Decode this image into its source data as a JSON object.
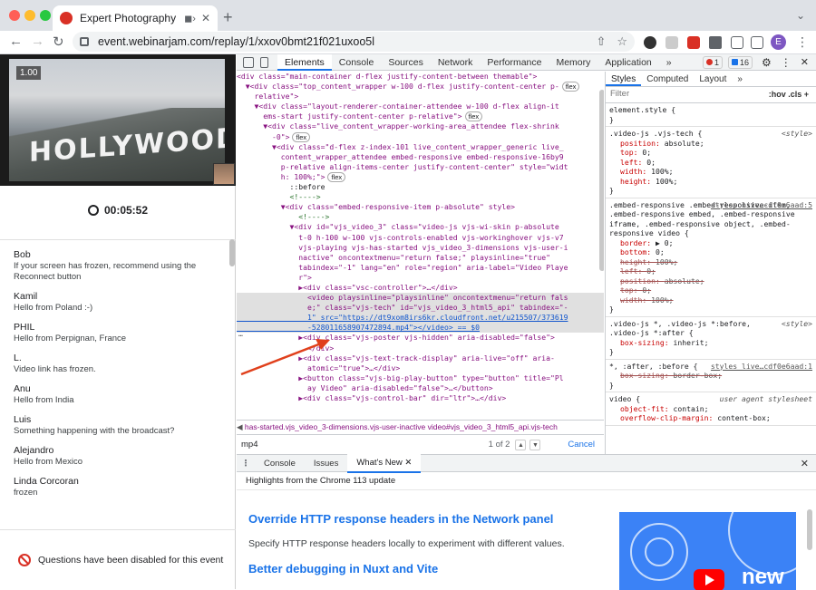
{
  "browser": {
    "tab_title": "Expert Photography Secre",
    "url": "event.webinarjam.com/replay/1/xxov0bmt21f021uxoo5l",
    "profile_initial": "E",
    "colors": {
      "close": "#ff5f57",
      "minimize": "#febc2e",
      "maximize": "#28c840",
      "tab_favicon": "#d93025"
    }
  },
  "webinar": {
    "speed": "1.00",
    "sign_text": "HOLLYWOOD",
    "timer": "00:05:52",
    "chat": [
      {
        "name": "Bob",
        "text": "If your screen has frozen, recommend using the Reconnect button"
      },
      {
        "name": "Kamil",
        "text": "Hello from Poland :-)"
      },
      {
        "name": "PHIL",
        "text": "Hello from Perpignan, France"
      },
      {
        "name": "L.",
        "text": "Video link has frozen."
      },
      {
        "name": "Anu",
        "text": "Hello from India"
      },
      {
        "name": "Luis",
        "text": "Something happening with the broadcast?"
      },
      {
        "name": "Alejandro",
        "text": "Hello from Mexico"
      },
      {
        "name": "Linda Corcoran",
        "text": "frozen"
      }
    ],
    "questions_disabled": "Questions have been disabled for this event"
  },
  "devtools": {
    "tabs": [
      "Elements",
      "Console",
      "Sources",
      "Network",
      "Performance",
      "Memory",
      "Application"
    ],
    "more_tabs": "»",
    "error_count": "1",
    "message_count": "16",
    "elements_lines": [
      "<div class=\"main-container d-flex justify-content-between themable\">",
      "  ▼<div class=\"top_content_wrapper w-100 d-flex justify-content-center p-",
      "    relative\">",
      "    ▼<div class=\"layout-renderer-container-attendee w-100 d-flex align-it",
      "      ems-start justify-content-center p-relative\">",
      "      ▼<div class=\"live_content_wrapper-working-area_attendee flex-shrink",
      "        -0\">",
      "        ▼<div class=\"d-flex z-index-101 live_content_wrapper_generic live_",
      "          content_wrapper_attendee embed-responsive embed-responsive-16by9",
      "          p-relative align-items-center justify-content-center\" style=\"widt",
      "          h: 100%;\">",
      "            ::before",
      "            <!---->",
      "          ▼<div class=\"embed-responsive-item p-absolute\" style>",
      "              <!---->",
      "            ▼<div id=\"vjs_video_3\" class=\"video-js vjs-wi-skin p-absolute",
      "              t-0 h-100 w-100 vjs-controls-enabled vjs-workinghover vjs-v7",
      "              vjs-playing vjs-has-started vjs_video_3-dimensions vjs-user-i",
      "              nactive\" oncontextmenu=\"return false;\" playsinline=\"true\"",
      "              tabindex=\"-1\" lang=\"en\" role=\"region\" aria-label=\"Video Playe",
      "              r\">",
      "              ▶<div class=\"vsc-controller\">…</div>",
      "                <video playsinline=\"playsinline\" oncontextmenu=\"return fals",
      "                e;\" class=\"vjs-tech\" id=\"vjs_video_3_html5_api\" tabindex=\"-",
      "                1\" src=\"https://dt9xom8irs6kr.cloudfront.net/u215507/373619",
      "                -528011658907472894.mp4\"></video> == $0",
      "              ▶<div class=\"vjs-poster vjs-hidden\" aria-disabled=\"false\">",
      "                </div>",
      "              ▶<div class=\"vjs-text-track-display\" aria-live=\"off\" aria-",
      "                atomic=\"true\">…</div>",
      "              ▶<button class=\"vjs-big-play-button\" type=\"button\" title=\"Pl",
      "                ay Video\" aria-disabled=\"false\">…</button>",
      "              ▶<div class=\"vjs-control-bar\" dir=\"ltr\">…</div>"
    ],
    "flex_badge": "flex",
    "breadcrumb": [
      "has-started.vjs_video_3-dimensions.vjs-user-inactive",
      "video#vjs_video_3_html5_api.vjs-tech"
    ],
    "search": {
      "query": "mp4",
      "count": "1 of 2",
      "cancel": "Cancel"
    },
    "styles_tabs": [
      "Styles",
      "Computed",
      "Layout",
      "»"
    ],
    "filter_placeholder": "Filter",
    "filter_tools": ":hov  .cls  +",
    "style_rules": [
      {
        "selector": "element.style {",
        "source": "",
        "props": [],
        "close": "}"
      },
      {
        "selector": ".video-js .vjs-tech {",
        "source": "<style>",
        "props": [
          {
            "p": "position",
            "v": "absolute;",
            "strike": false
          },
          {
            "p": "top",
            "v": "0;",
            "strike": false
          },
          {
            "p": "left",
            "v": "0;",
            "strike": false
          },
          {
            "p": "width",
            "v": "100%;",
            "strike": false
          },
          {
            "p": "height",
            "v": "100%;",
            "strike": false
          }
        ],
        "close": "}"
      },
      {
        "selector": ".embed-responsive .embed-responsive-item, .embed-responsive embed, .embed-responsive iframe, .embed-responsive object, .embed-responsive video {",
        "source": "styles_live…cdf0e6aad:5",
        "props": [
          {
            "p": "border",
            "v": "▶ 0;",
            "strike": false
          },
          {
            "p": "bottom",
            "v": "0;",
            "strike": false
          },
          {
            "p": "height",
            "v": "100%;",
            "strike": true
          },
          {
            "p": "left",
            "v": "0;",
            "strike": true
          },
          {
            "p": "position",
            "v": "absolute;",
            "strike": true
          },
          {
            "p": "top",
            "v": "0;",
            "strike": true
          },
          {
            "p": "width",
            "v": "100%;",
            "strike": true
          }
        ],
        "close": "}"
      },
      {
        "selector": ".video-js *, .video-js *:before, .video-js *:after {",
        "source": "<style>",
        "props": [
          {
            "p": "box-sizing",
            "v": "inherit;",
            "strike": false
          }
        ],
        "close": "}"
      },
      {
        "selector": "*, :after, :before {",
        "source": "styles_live…cdf0e6aad:1",
        "props": [
          {
            "p": "box-sizing",
            "v": "border-box;",
            "strike": true
          }
        ],
        "close": "}"
      },
      {
        "selector": "video {",
        "source": "user agent stylesheet",
        "props": [
          {
            "p": "object-fit",
            "v": "contain;",
            "strike": false
          },
          {
            "p": "overflow-clip-margin",
            "v": "content-box;",
            "strike": false
          }
        ],
        "close": ""
      }
    ],
    "drawer": {
      "tabs": [
        "Console",
        "Issues",
        "What's New"
      ],
      "highlights": "Highlights from the Chrome 113 update",
      "heading1": "Override HTTP response headers in the Network panel",
      "para1": "Specify HTTP response headers locally to experiment with different values.",
      "heading2": "Better debugging in Nuxt and Vite",
      "thumb_label": "new"
    }
  }
}
